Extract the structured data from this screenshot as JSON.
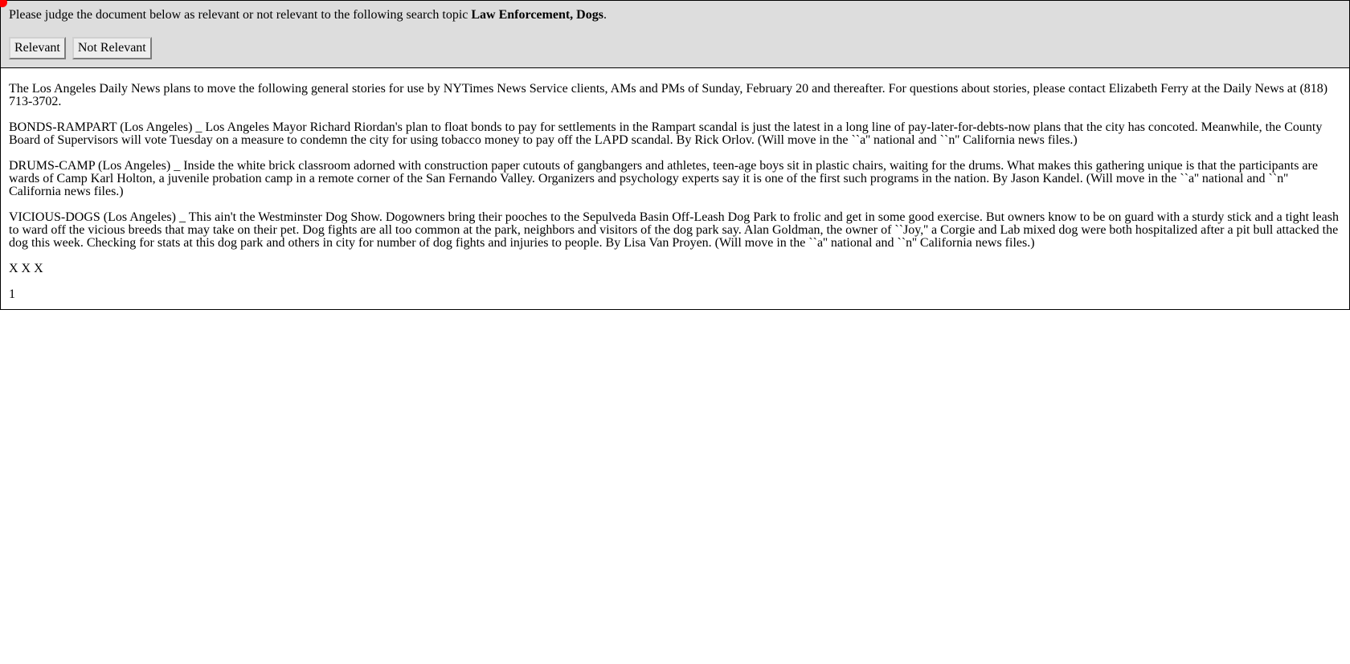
{
  "header": {
    "prompt_prefix": "Please judge the document below as relevant or not relevant to the following search topic",
    "topic": "Law Enforcement, Dogs",
    "prompt_suffix": ".",
    "relevant_label": "Relevant",
    "not_relevant_label": "Not Relevant"
  },
  "document": {
    "paragraphs": [
      "The Los Angeles Daily News plans to move the following general stories for use by NYTimes News Service clients, AMs and PMs of Sunday, February 20 and thereafter. For questions about stories, please contact Elizabeth Ferry at the Daily News at (818) 713-3702.",
      "BONDS-RAMPART (Los Angeles) _ Los Angeles Mayor Richard Riordan's plan to float bonds to pay for settlements in the Rampart scandal is just the latest in a long line of pay-later-for-debts-now plans that the city has concoted. Meanwhile, the County Board of Supervisors will vote Tuesday on a measure to condemn the city for using tobacco money to pay off the LAPD scandal. By Rick Orlov. (Will move in the ``a'' national and ``n'' California news files.)",
      "DRUMS-CAMP (Los Angeles) _ Inside the white brick classroom adorned with construction paper cutouts of gangbangers and athletes, teen-age boys sit in plastic chairs, waiting for the drums. What makes this gathering unique is that the participants are wards of Camp Karl Holton, a juvenile probation camp in a remote corner of the San Fernando Valley. Organizers and psychology experts say it is one of the first such programs in the nation. By Jason Kandel. (Will move in the ``a'' national and ``n'' California news files.)",
      "VICIOUS-DOGS (Los Angeles) _ This ain't the Westminster Dog Show. Dogowners bring their pooches to the Sepulveda Basin Off-Leash Dog Park to frolic and get in some good exercise. But owners know to be on guard with a sturdy stick and a tight leash to ward off the vicious breeds that may take on their pet. Dog fights are all too common at the park, neighbors and visitors of the dog park say. Alan Goldman, the owner of ``Joy,'' a Corgie and Lab mixed dog were both hospitalized after a pit bull attacked the dog this week. Checking for stats at this dog park and others in city for number of dog fights and injuries to people. By Lisa Van Proyen. (Will move in the ``a'' national and ``n'' California news files.)",
      "X X X",
      "1"
    ]
  }
}
